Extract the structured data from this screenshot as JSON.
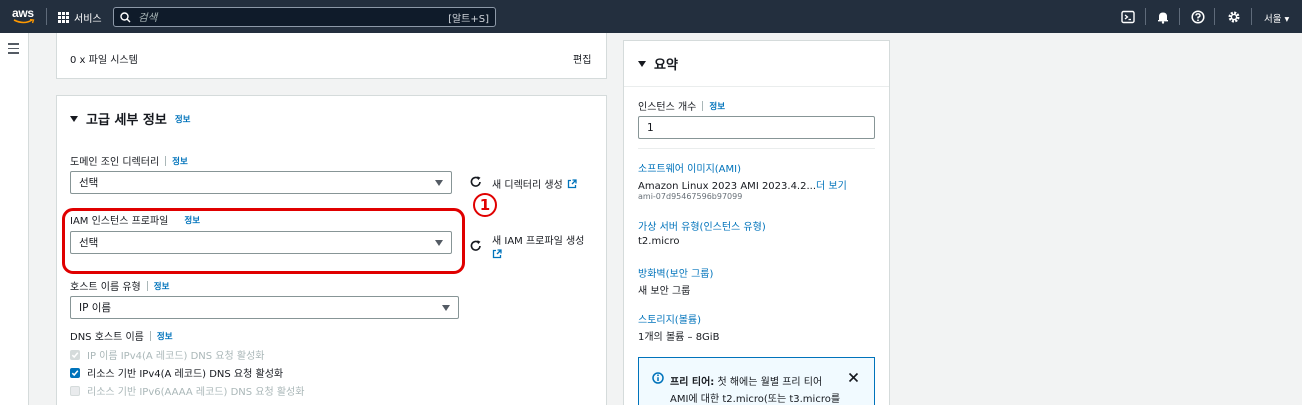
{
  "topbar": {
    "logo_text": "aws",
    "services_label": "서비스",
    "search_placeholder": "검색",
    "search_shortcut": "[알트+S]",
    "region_label": "서울 ▾",
    "icons": [
      "terminal-icon",
      "bell-icon",
      "help-icon",
      "gear-icon"
    ]
  },
  "storage_row": {
    "text": "0 x 파일 시스템",
    "edit_label": "편집"
  },
  "advanced": {
    "heading": "고급 세부 정보",
    "info_label": "정보",
    "domain_join": {
      "label": "도메인 조인 디렉터리",
      "info": "정보",
      "value": "선택",
      "create_link": "새 디렉터리 생성"
    },
    "iam_profile": {
      "label": "IAM 인스턴스 프로파일",
      "info": "정보",
      "value": "선택",
      "create_link_line1": "새 IAM 프로파일 생성"
    },
    "annotation_number": "1",
    "hostname_type": {
      "label": "호스트 이름 유형",
      "info": "정보",
      "value": "IP 이름"
    },
    "dns_hostname": {
      "label": "DNS 호스트 이름",
      "info": "정보",
      "options": [
        {
          "label": "IP 이름 IPv4(A 레코드) DNS 요청 활성화",
          "checked": true,
          "disabled": true
        },
        {
          "label": "리소스 기반 IPv4(A 레코드) DNS 요청 활성화",
          "checked": true,
          "disabled": false
        },
        {
          "label": "리소스 기반 IPv6(AAAA 레코드) DNS 요청 활성화",
          "checked": false,
          "disabled": true
        }
      ]
    }
  },
  "summary": {
    "heading": "요약",
    "instance_count_label": "인스턴스 개수",
    "instance_count_info": "정보",
    "instance_count_value": "1",
    "ami_label": "소프트웨어 이미지(AMI)",
    "ami_value": "Amazon Linux 2023 AMI 2023.4.2...",
    "ami_more": "더 보기",
    "ami_id": "ami-07d95467596b97099",
    "instance_type_label": "가상 서버 유형(인스턴스 유형)",
    "instance_type_value": "t2.micro",
    "firewall_label": "방화벽(보안 그룹)",
    "firewall_value": "새 보안 그룹",
    "storage_label": "스토리지(볼륨)",
    "storage_value": "1개의 볼륨 – 8GiB",
    "free_tier_title": "프리 티어:",
    "free_tier_line1": "첫 해에는 월별 프리 티어",
    "free_tier_line2": "AMI에 대한 t2.micro(또는 t3.micro를"
  },
  "colors": {
    "topbar": "#232f3e",
    "link": "#0073bb",
    "annotation": "#e00000"
  }
}
